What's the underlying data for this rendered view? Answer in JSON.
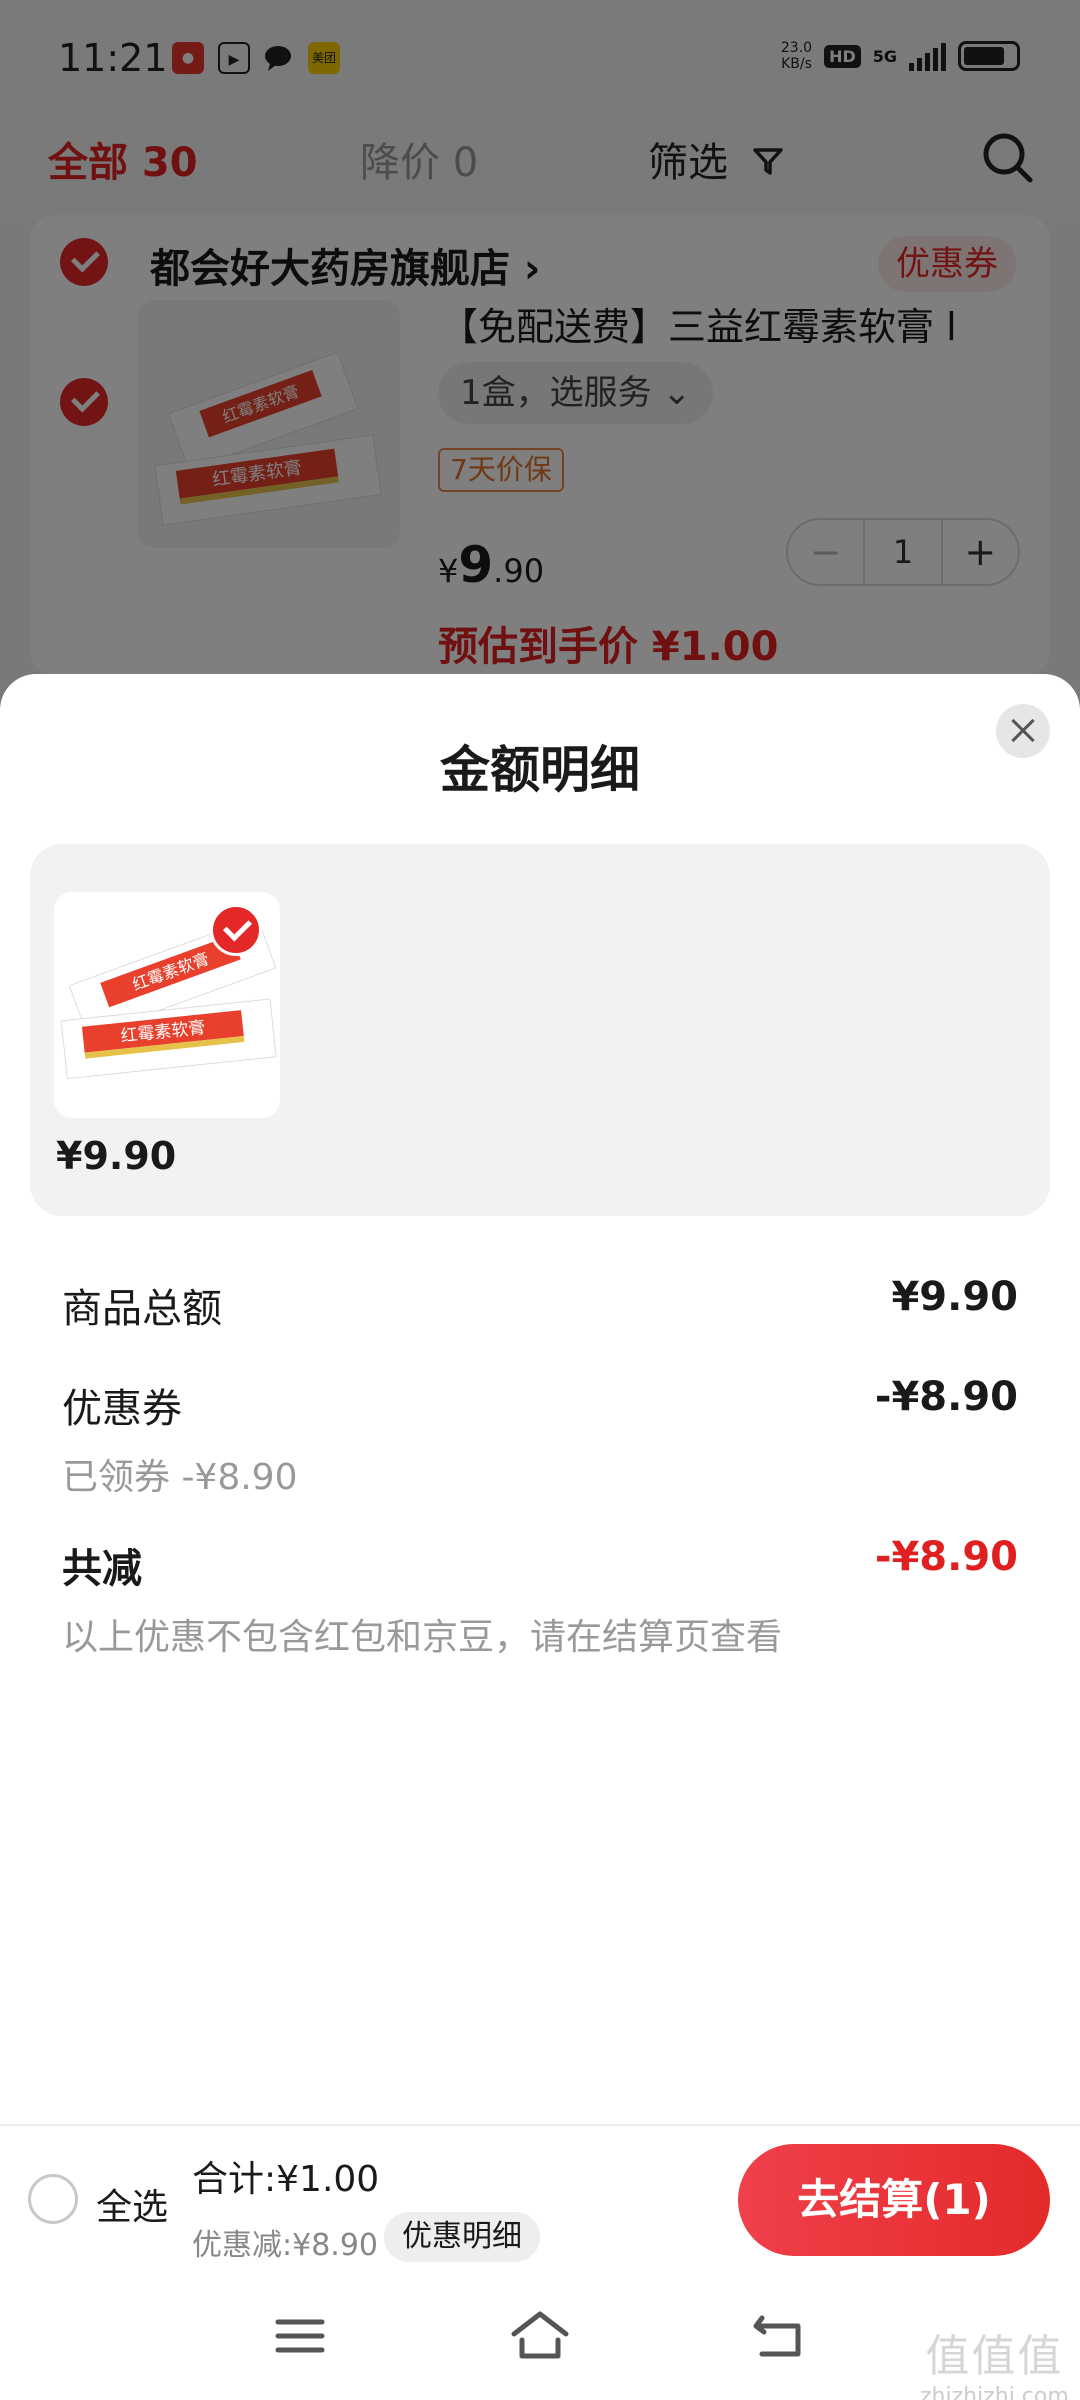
{
  "status_bar": {
    "time": "11:21",
    "net_speed_value": "23.0",
    "net_speed_unit": "KB/s",
    "hd": "HD",
    "network": "5G",
    "app_icons": [
      "jd-icon",
      "video-icon",
      "chat-icon",
      "meituan-icon"
    ],
    "meituan_label": "美团"
  },
  "tabs": {
    "all_label": "全部 30",
    "price_drop_label": "降价 0",
    "filter_label": "筛选"
  },
  "store": {
    "name": "都会好大药房旗舰店 ›",
    "coupon_tag": "优惠券"
  },
  "product": {
    "title": "【免配送费】三益红霉素软膏 l",
    "sku": "1盒，选服务 ⌄",
    "price_protect": "7天价保",
    "price_symbol": "¥",
    "price_int": "9",
    "price_dec": ".90",
    "quantity": "1",
    "minus": "−",
    "plus": "+",
    "estimated_price": "预估到手价 ¥1.00",
    "box_label": "红霉素软膏"
  },
  "sheet": {
    "title": "金额明细",
    "goods_price": "¥9.90",
    "rows": {
      "subtotal_label": "商品总额",
      "subtotal_value": "¥9.90",
      "coupon_label": "优惠券",
      "coupon_value": "-¥8.90",
      "coupon_sub": "已领券 -¥8.90",
      "total_reduce_label": "共减",
      "total_reduce_value": "-¥8.90",
      "note": "以上优惠不包含红包和京豆，请在结算页查看"
    }
  },
  "checkout": {
    "select_all": "全选",
    "total": "合计:¥1.00",
    "discount": "优惠减:¥8.90",
    "discount_detail": "优惠明细",
    "button": "去结算(1)"
  },
  "watermark": {
    "main": "值值值",
    "sub": "zhizhizhi.com"
  },
  "colors": {
    "accent_red": "#e42828",
    "price_red": "#e02020"
  }
}
